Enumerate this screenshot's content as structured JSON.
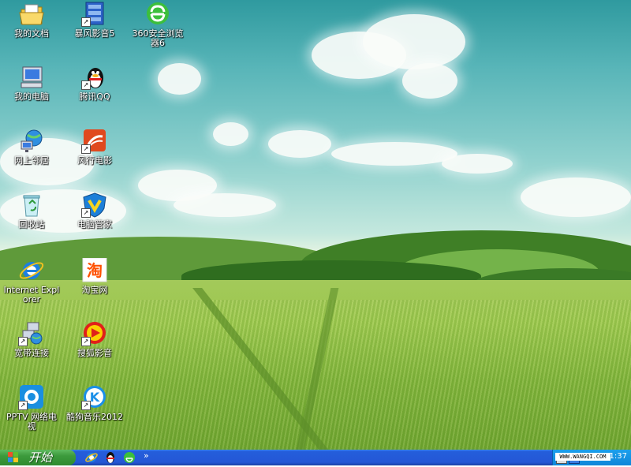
{
  "desktop": {
    "icons": [
      {
        "label": "我的文档",
        "icon": "my-documents-icon"
      },
      {
        "label": "暴风影音5",
        "icon": "storm-player-icon"
      },
      {
        "label": "360安全浏览器6",
        "icon": "360-browser-icon"
      },
      {
        "label": "我的电脑",
        "icon": "my-computer-icon"
      },
      {
        "label": "腾讯QQ",
        "icon": "qq-penguin-icon"
      },
      {
        "label": "网上邻居",
        "icon": "network-places-icon"
      },
      {
        "label": "风行电影",
        "icon": "funshion-icon"
      },
      {
        "label": "回收站",
        "icon": "recycle-bin-icon"
      },
      {
        "label": "电脑管家",
        "icon": "pc-manager-shield-icon"
      },
      {
        "label": "Internet Explorer",
        "icon": "internet-explorer-icon"
      },
      {
        "label": "淘宝网",
        "icon": "taobao-icon"
      },
      {
        "label": "宽带连接",
        "icon": "broadband-connection-icon"
      },
      {
        "label": "搜狐影音",
        "icon": "sohu-video-icon"
      },
      {
        "label": "PPTV 网络电视",
        "icon": "pptv-icon"
      },
      {
        "label": "酷狗音乐2012",
        "icon": "kugou-music-icon"
      }
    ]
  },
  "taskbar": {
    "start_label": "开始",
    "quick_launch": [
      "internet-explorer-icon",
      "qq-icon",
      "360-browser-icon"
    ],
    "chevron": "»",
    "clock": "21:37",
    "watermark": "WWW.WANGQI.COM"
  },
  "colors": {
    "taskbar_blue": "#245edb",
    "start_green": "#3c9a3c",
    "tray_blue": "#0f86d9"
  }
}
